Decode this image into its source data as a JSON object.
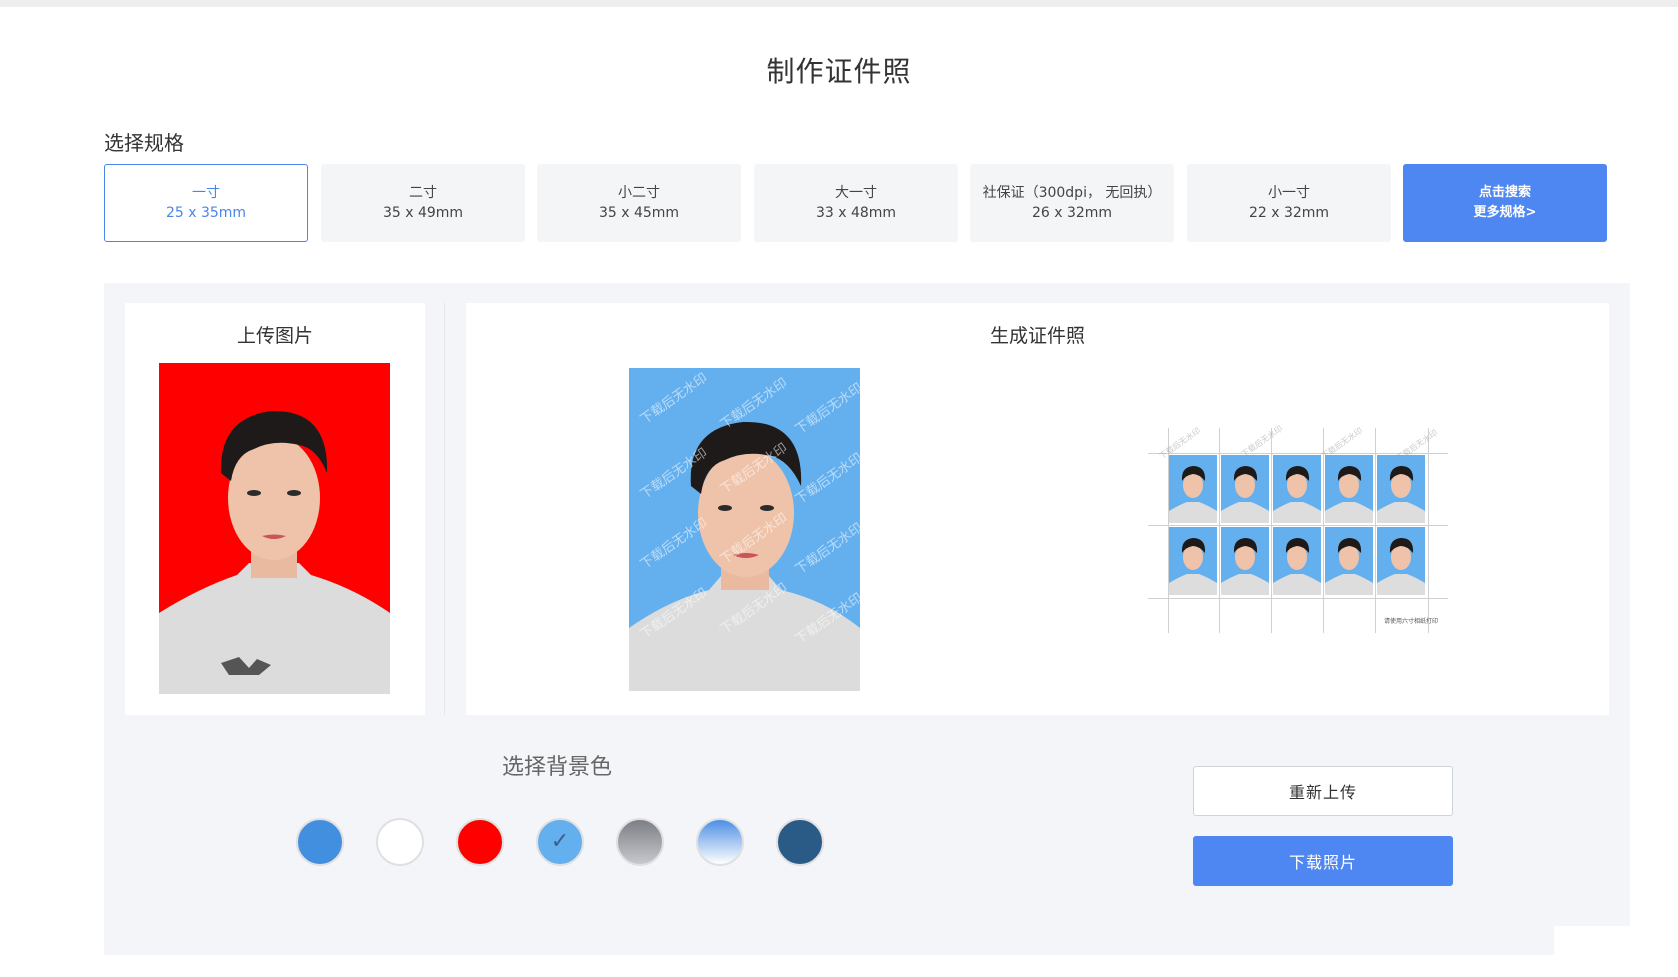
{
  "page": {
    "title": "制作证件照"
  },
  "specs": {
    "label": "选择规格",
    "items": [
      {
        "name": "一寸",
        "size": "25 x 35mm",
        "selected": true
      },
      {
        "name": "二寸",
        "size": "35 x 49mm"
      },
      {
        "name": "小二寸",
        "size": "35 x 45mm"
      },
      {
        "name": "大一寸",
        "size": "33 x 48mm"
      },
      {
        "name": "社保证（300dpi， 无回执）",
        "size": "26 x 32mm"
      },
      {
        "name": "小一寸",
        "size": "22 x 32mm"
      }
    ],
    "more": {
      "line1": "点击搜索",
      "line2": "更多规格>"
    }
  },
  "upload": {
    "title": "上传图片",
    "photo_background": "#ff0000"
  },
  "result": {
    "title": "生成证件照",
    "photo_background": "#64b0ef",
    "watermark": "下载后无水印",
    "sheet_note": "请使用六寸相纸打印"
  },
  "background": {
    "label": "选择背景色",
    "selected_index": 3,
    "colors": [
      "#438fdf",
      "#ffffff",
      "#ff0000",
      "#64b0ef",
      "gradient-gray",
      "gradient-blue",
      "#2a5a86"
    ]
  },
  "actions": {
    "reupload": "重新上传",
    "download": "下载照片"
  },
  "colors": {
    "accent": "#4e86f2",
    "selected_border": "#4a86e8"
  }
}
